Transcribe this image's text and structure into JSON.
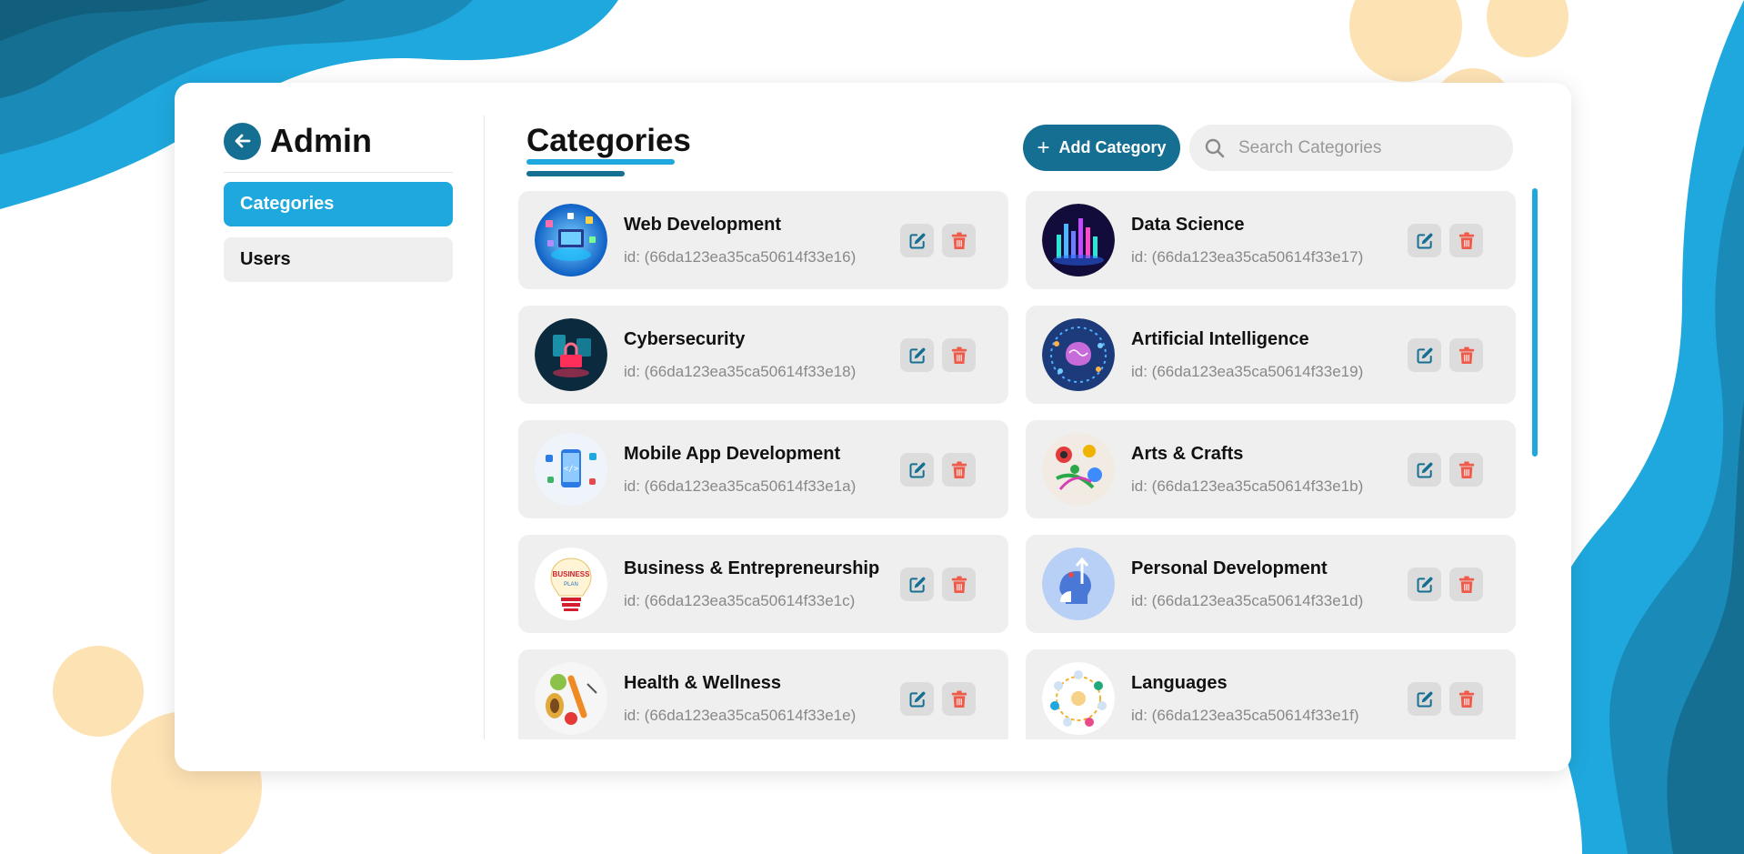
{
  "sidebar": {
    "title": "Admin",
    "items": [
      {
        "label": "Categories",
        "active": true
      },
      {
        "label": "Users",
        "active": false
      }
    ]
  },
  "main": {
    "title": "Categories",
    "add_button_label": "Add Category",
    "search_placeholder": "Search Categories"
  },
  "categories": [
    {
      "name": "Web Development",
      "id_text": "id: (66da123ea35ca50614f33e16)",
      "icon": "web-development-thumb"
    },
    {
      "name": "Data Science",
      "id_text": "id: (66da123ea35ca50614f33e17)",
      "icon": "data-science-thumb"
    },
    {
      "name": "Cybersecurity",
      "id_text": "id: (66da123ea35ca50614f33e18)",
      "icon": "cybersecurity-thumb"
    },
    {
      "name": "Artificial Intelligence",
      "id_text": "id: (66da123ea35ca50614f33e19)",
      "icon": "ai-brain-thumb"
    },
    {
      "name": "Mobile App Development",
      "id_text": "id: (66da123ea35ca50614f33e1a)",
      "icon": "mobile-app-thumb"
    },
    {
      "name": "Arts & Crafts",
      "id_text": "id: (66da123ea35ca50614f33e1b)",
      "icon": "arts-crafts-thumb"
    },
    {
      "name": "Business & Entrepreneurship",
      "id_text": "id: (66da123ea35ca50614f33e1c)",
      "icon": "business-lightbulb-thumb"
    },
    {
      "name": "Personal Development",
      "id_text": "id: (66da123ea35ca50614f33e1d)",
      "icon": "personal-development-thumb"
    },
    {
      "name": "Health & Wellness",
      "id_text": "id: (66da123ea35ca50614f33e1e)",
      "icon": "health-food-thumb"
    },
    {
      "name": "Languages",
      "id_text": "id: (66da123ea35ca50614f33e1f)",
      "icon": "languages-thumb"
    }
  ],
  "colors": {
    "primary_dark": "#156f92",
    "primary_light": "#1fa8de",
    "delete_red": "#ef5b4a",
    "card_bg": "#efefef",
    "blob_peach": "#fde2b4"
  }
}
